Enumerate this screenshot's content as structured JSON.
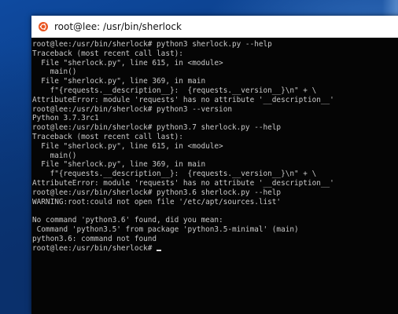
{
  "window": {
    "title": "root@lee: /usr/bin/sherlock",
    "icon": "ubuntu-icon"
  },
  "terminal": {
    "lines": [
      "root@lee:/usr/bin/sherlock# python3 sherlock.py --help",
      "Traceback (most recent call last):",
      "  File \"sherlock.py\", line 615, in <module>",
      "    main()",
      "  File \"sherlock.py\", line 369, in main",
      "    f\"{requests.__description__}:  {requests.__version__}\\n\" + \\",
      "AttributeError: module 'requests' has no attribute '__description__'",
      "root@lee:/usr/bin/sherlock# python3 --version",
      "Python 3.7.3rc1",
      "root@lee:/usr/bin/sherlock# python3.7 sherlock.py --help",
      "Traceback (most recent call last):",
      "  File \"sherlock.py\", line 615, in <module>",
      "    main()",
      "  File \"sherlock.py\", line 369, in main",
      "    f\"{requests.__description__}:  {requests.__version__}\\n\" + \\",
      "AttributeError: module 'requests' has no attribute '__description__'",
      "root@lee:/usr/bin/sherlock# python3.6 sherlock.py --help",
      "WARNING:root:could not open file '/etc/apt/sources.list'",
      "",
      "No command 'python3.6' found, did you mean:",
      " Command 'python3.5' from package 'python3.5-minimal' (main)",
      "python3.6: command not found"
    ],
    "prompt": "root@lee:/usr/bin/sherlock# "
  }
}
